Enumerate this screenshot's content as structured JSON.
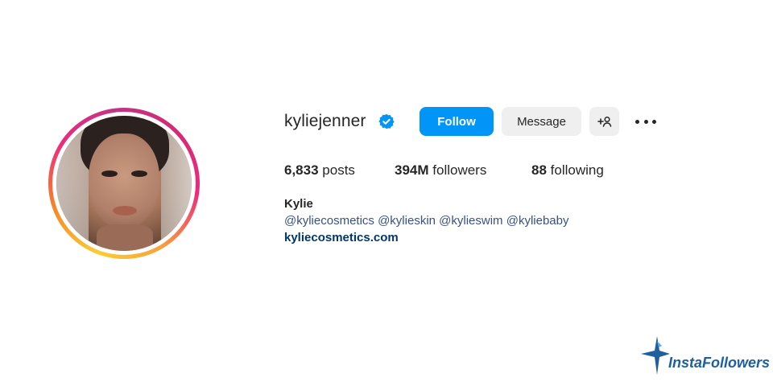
{
  "profile": {
    "username": "kyliejenner",
    "verified": true,
    "display_name": "Kylie",
    "bio": "@kyliecosmetics @kylieskin @kylieswim @kyliebaby",
    "website": "kyliecosmetics.com"
  },
  "actions": {
    "follow_label": "Follow",
    "message_label": "Message",
    "add_user_icon": "add-user-icon",
    "more_icon": "more-options-icon"
  },
  "stats": {
    "posts_count": "6,833",
    "posts_label": "posts",
    "followers_count": "394M",
    "followers_label": "followers",
    "following_count": "88",
    "following_label": "following"
  },
  "watermark": {
    "text": "InstaFollowers"
  },
  "colors": {
    "primary_button": "#0095f6",
    "secondary_button": "#efefef",
    "verified_badge": "#0095f6",
    "link": "#00376b",
    "watermark": "#1f5f9e"
  }
}
